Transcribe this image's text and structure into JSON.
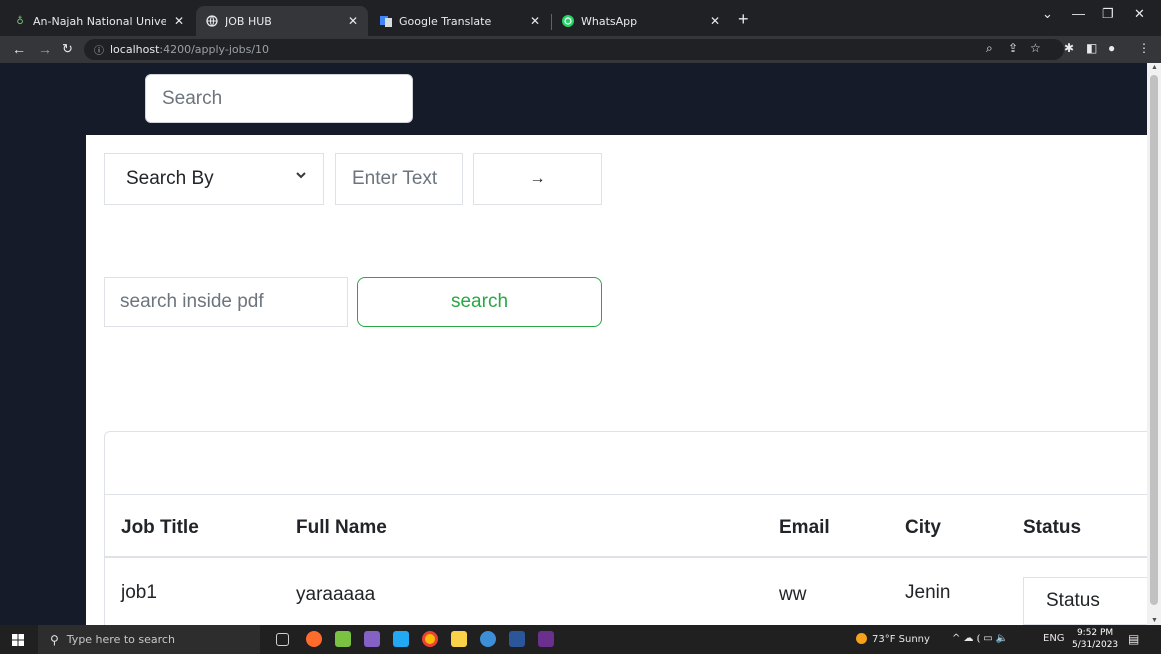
{
  "browser": {
    "tabs": [
      {
        "title": "An-Najah National University ten",
        "icon": "leaf-icon",
        "active": false
      },
      {
        "title": "JOB HUB",
        "icon": "globe-icon",
        "active": true
      },
      {
        "title": "Google Translate",
        "icon": "translate-icon",
        "active": false
      },
      {
        "title": "WhatsApp",
        "icon": "whatsapp-icon",
        "active": false
      }
    ],
    "url_host": "localhost",
    "url_path": ":4200/apply-jobs/10"
  },
  "header": {
    "search_placeholder": "Search"
  },
  "filters": {
    "search_by_label": "Search By",
    "text_placeholder": "Enter Text",
    "go_label": "→"
  },
  "pdf_search": {
    "placeholder": "search inside pdf",
    "button_label": "search"
  },
  "table": {
    "columns": [
      "Job Title",
      "Full Name",
      "Email",
      "City",
      "Status"
    ],
    "rows": [
      {
        "job_title": "job1",
        "full_name": "yaraaaaa",
        "email": "ww",
        "city": "Jenin",
        "status": "Status"
      }
    ]
  },
  "taskbar": {
    "search_placeholder": "Type here to search",
    "weather": "73°F  Sunny",
    "language": "ENG",
    "time": "9:52 PM",
    "date": "5/31/2023"
  },
  "colors": {
    "page_header_bg": "#161b2a",
    "success_green": "#28a745"
  }
}
